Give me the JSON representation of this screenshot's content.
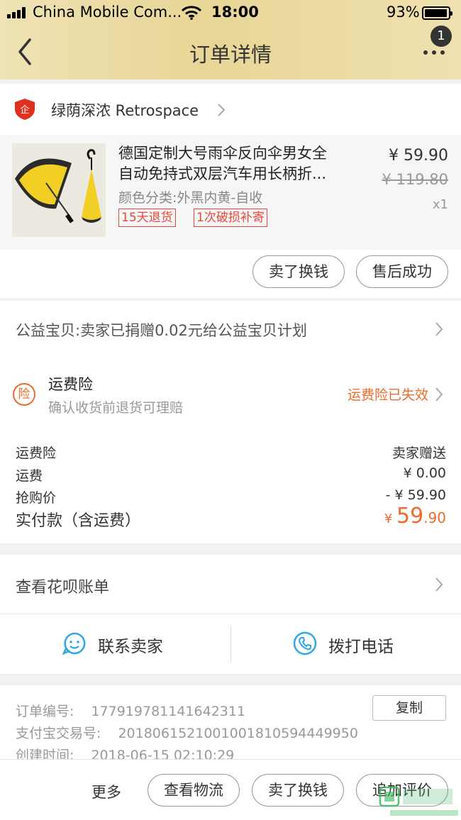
{
  "status_bar": {
    "carrier": "China Mobile Com...",
    "time": "18:00",
    "battery": "93%"
  },
  "nav": {
    "title": "订单详情",
    "badge": "1"
  },
  "shop": {
    "name": "绿荫深浓 Retrospace"
  },
  "item": {
    "title_line1": "德国定制大号雨伞反向伞男女全",
    "title_line2": "自动免持式双层汽车用长柄折...",
    "sku": "颜色分类:外黑内黄-自收",
    "tag1": "15天退货",
    "tag2": "1次破损补寄",
    "price": "¥ 59.90",
    "original_price": "¥ 119.80",
    "quantity": "x1",
    "btn_sell": "卖了换钱",
    "btn_after_sale": "售后成功"
  },
  "charity": {
    "text": "公益宝贝:卖家已捐赠0.02元给公益宝贝计划"
  },
  "insurance": {
    "icon_char": "险",
    "title": "运费险",
    "subtitle": "确认收货前退货可理赔",
    "status": "运费险已失效"
  },
  "fees": [
    {
      "label": "运费险",
      "value": "卖家赠送"
    },
    {
      "label": "运费",
      "value": "¥ 0.00"
    },
    {
      "label": "抢购价",
      "value": "- ¥ 59.90"
    }
  ],
  "total": {
    "label": "实付款（含运费）",
    "currency": "¥ ",
    "integer": "59",
    "decimal": ".90"
  },
  "huabei": {
    "text": "查看花呗账单"
  },
  "contact": {
    "seller": "联系卖家",
    "phone": "拨打电话"
  },
  "order_info": {
    "order_no_label": "订单编号:",
    "order_no": "177919781141642311",
    "alipay_label": "支付宝交易号:",
    "alipay_no": "2018061521001001810594449950",
    "created_label": "创建时间:",
    "created": "2018-06-15 02:10:29",
    "copy_label": "复制"
  },
  "bottom_bar": {
    "more": "更多",
    "logistics": "查看物流",
    "sell": "卖了换钱",
    "review": "追加评价"
  },
  "colors": {
    "accent": "#f06a2b",
    "tag_red": "#e8463c",
    "nav_gold": "#e8d697",
    "contact_blue": "#2ea6e8"
  },
  "icons": [
    "back-icon",
    "more-icon",
    "shop-logo-icon",
    "chevron-right-icon",
    "insurance-icon",
    "seller-chat-icon",
    "phone-icon"
  ]
}
